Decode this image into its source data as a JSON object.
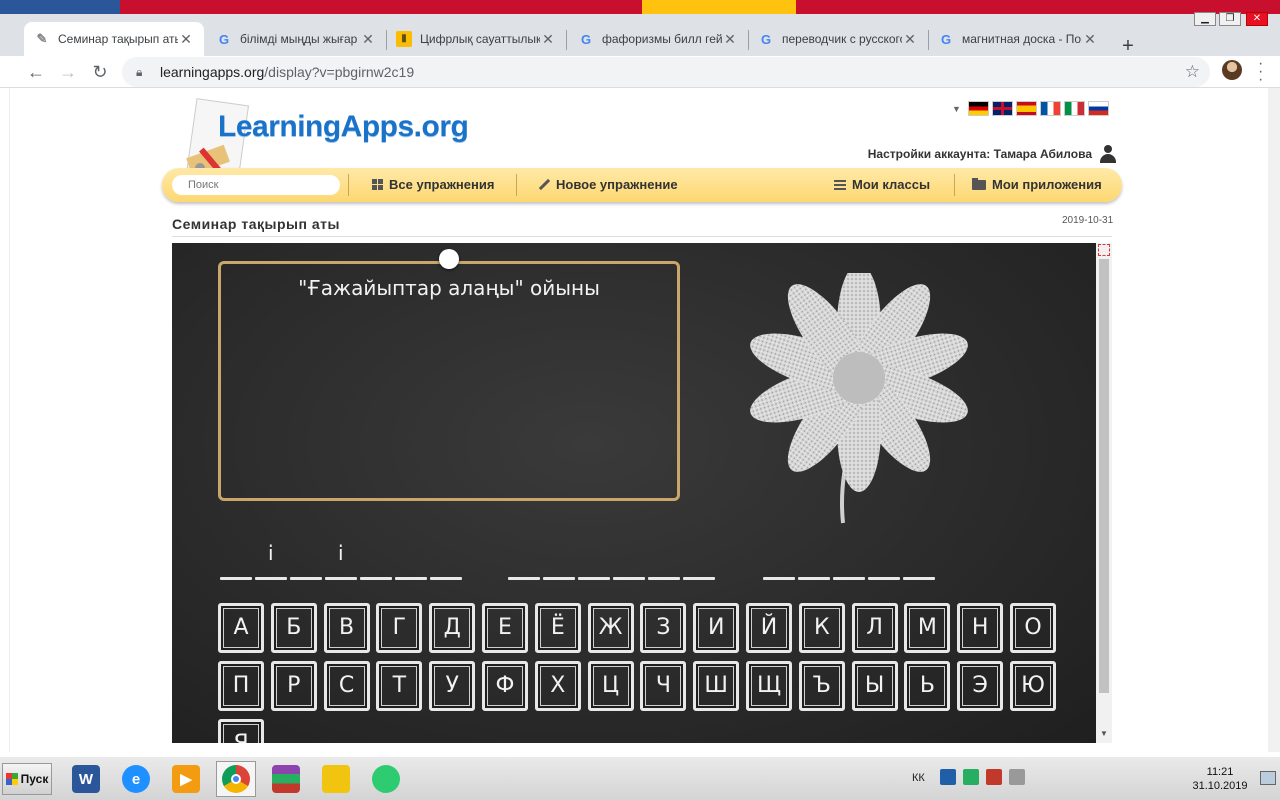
{
  "browser": {
    "tabs": [
      {
        "title": "Семинар тақырып аты",
        "favicon": "learningapps-favicon",
        "active": true
      },
      {
        "title": "білімді мыңды жығар с",
        "favicon": "google-icon",
        "active": false
      },
      {
        "title": "Цифрлық сауаттылық",
        "favicon": "yellow-doc-icon",
        "active": false
      },
      {
        "title": "фафоризмы билл гейтс",
        "favicon": "google-icon",
        "active": false
      },
      {
        "title": "переводчик с русского",
        "favicon": "google-icon",
        "active": false
      },
      {
        "title": "магнитная доска - Пои",
        "favicon": "google-icon",
        "active": false
      }
    ],
    "address": {
      "host": "learningapps.org",
      "path": "/display?v=pbgirnw2c19"
    }
  },
  "site": {
    "logo_text": "LearningApps.org",
    "languages": [
      "de",
      "en",
      "es",
      "fr",
      "it",
      "ru"
    ],
    "account_label": "Настройки аккаунта: Тамара Абилова",
    "search_placeholder": "Поиск",
    "menu": {
      "all_exercises": "Все упражнения",
      "new_exercise": "Новое упражнение",
      "my_classes": "Мои классы",
      "my_apps": "Мои приложения"
    },
    "page_title": "Семинар тақырып аты",
    "page_date": "2019-10-31"
  },
  "app": {
    "question": "\"Ғажайыптар алаңы\" ойыны",
    "revealed_letters": [
      "і",
      "і"
    ],
    "keys_row1": [
      "А",
      "Б",
      "В",
      "Г",
      "Д",
      "Е",
      "Ё",
      "Ж",
      "З",
      "И",
      "Й",
      "К",
      "Л",
      "М",
      "Н",
      "О"
    ],
    "keys_row2": [
      "П",
      "Р",
      "С",
      "Т",
      "У",
      "Ф",
      "Х",
      "Ц",
      "Ч",
      "Ш",
      "Щ",
      "Ъ",
      "Ы",
      "Ь",
      "Э",
      "Ю"
    ],
    "keys_row3": [
      "Я"
    ],
    "colors": {
      "board": "#2e2e2e",
      "frame": "#c9a76a",
      "chalk": "#f2f2f2",
      "menubar": "#fdd871"
    }
  },
  "taskbar": {
    "start_label": "Пуск",
    "apps": [
      "word-icon",
      "ie-icon",
      "media-player-icon",
      "chrome-icon",
      "winrar-icon",
      "explorer-icon",
      "chat-icon"
    ],
    "language": "КК",
    "time": "11:21",
    "date": "31.10.2019"
  }
}
